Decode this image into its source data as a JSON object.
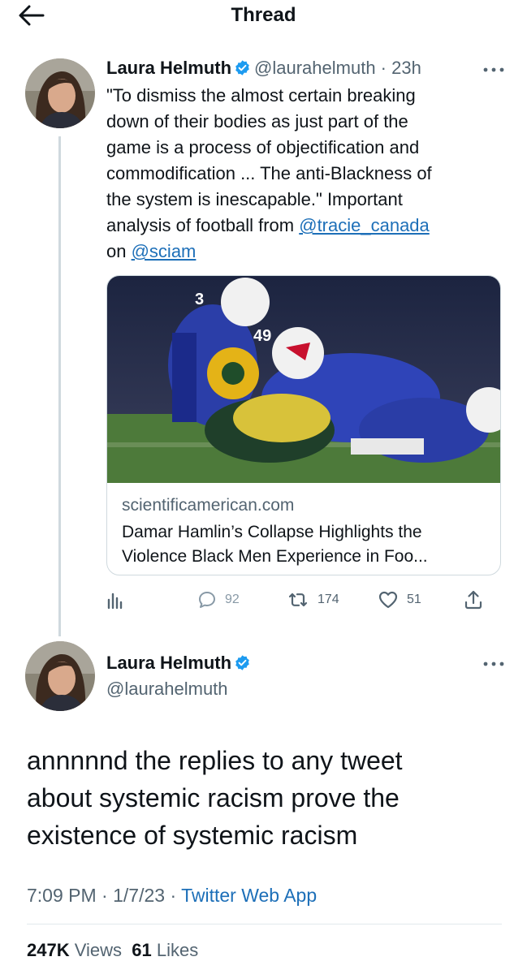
{
  "header": {
    "title": "Thread"
  },
  "tweet1": {
    "author_name": "Laura Helmuth",
    "handle": "@laurahelmuth",
    "separator": " · ",
    "time": "23h",
    "text_line1": "\"To dismiss the almost certain breaking",
    "text_line2": "down of their bodies as just part of the",
    "text_line3": "game is a process of objectification and",
    "text_line4": "commodification ... The anti-Blackness of",
    "text_line5": "the system is inescapable.\" Important",
    "text_line6_prefix": "analysis of football from ",
    "mention1": "@tracie_canada",
    "text_line7_prefix": "on ",
    "mention2": "@sciam",
    "card": {
      "domain": "scientificamerican.com",
      "title_line1": "Damar Hamlin’s Collapse Highlights the",
      "title_line2": "Violence Black Men Experience in Foo..."
    },
    "actions": {
      "replies": "92",
      "retweets": "174",
      "likes": "51"
    }
  },
  "tweet2": {
    "author_name": "Laura Helmuth",
    "handle": "@laurahelmuth",
    "text_line1": "annnnnd the replies to any tweet",
    "text_line2": "about systemic racism prove the",
    "text_line3": "existence of systemic racism",
    "time": "7:09 PM",
    "date": "1/7/23",
    "separator": " · ",
    "app": "Twitter Web App",
    "views_count": "247K",
    "views_label": "Views",
    "likes_count": "61",
    "likes_label": "Likes"
  },
  "icons": {
    "back": "back-arrow-icon",
    "verified": "verified-badge-icon",
    "more": "more-dots-icon",
    "analytics": "analytics-icon",
    "reply": "reply-icon",
    "retweet": "retweet-icon",
    "like": "heart-icon",
    "share": "share-icon"
  },
  "colors": {
    "verified": "#1d9bf0",
    "link": "#1d6fb8",
    "muted": "#536471",
    "text": "#0f1419"
  }
}
